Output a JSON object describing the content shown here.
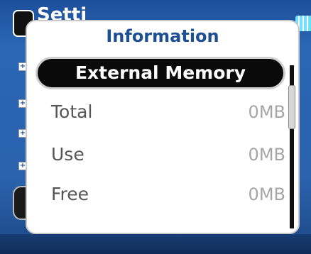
{
  "background": {
    "title": "Setti"
  },
  "dialog": {
    "title": "Information",
    "section_header": "External Memory",
    "rows": [
      {
        "label": "Total",
        "value": "0MB"
      },
      {
        "label": "Use",
        "value": "0MB"
      },
      {
        "label": "Free",
        "value": "0MB"
      }
    ]
  },
  "colors": {
    "background_blue": "#2a66b4",
    "title_blue": "#1d4f94",
    "label_gray": "#555555",
    "value_gray": "#a5a5a5"
  }
}
